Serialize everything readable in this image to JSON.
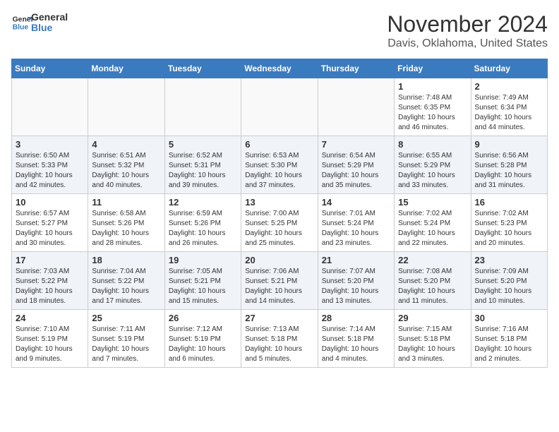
{
  "logo": {
    "line1": "General",
    "line2": "Blue"
  },
  "title": "November 2024",
  "location": "Davis, Oklahoma, United States",
  "weekdays": [
    "Sunday",
    "Monday",
    "Tuesday",
    "Wednesday",
    "Thursday",
    "Friday",
    "Saturday"
  ],
  "weeks": [
    [
      {
        "day": "",
        "info": ""
      },
      {
        "day": "",
        "info": ""
      },
      {
        "day": "",
        "info": ""
      },
      {
        "day": "",
        "info": ""
      },
      {
        "day": "",
        "info": ""
      },
      {
        "day": "1",
        "info": "Sunrise: 7:48 AM\nSunset: 6:35 PM\nDaylight: 10 hours and 46 minutes."
      },
      {
        "day": "2",
        "info": "Sunrise: 7:49 AM\nSunset: 6:34 PM\nDaylight: 10 hours and 44 minutes."
      }
    ],
    [
      {
        "day": "3",
        "info": "Sunrise: 6:50 AM\nSunset: 5:33 PM\nDaylight: 10 hours and 42 minutes."
      },
      {
        "day": "4",
        "info": "Sunrise: 6:51 AM\nSunset: 5:32 PM\nDaylight: 10 hours and 40 minutes."
      },
      {
        "day": "5",
        "info": "Sunrise: 6:52 AM\nSunset: 5:31 PM\nDaylight: 10 hours and 39 minutes."
      },
      {
        "day": "6",
        "info": "Sunrise: 6:53 AM\nSunset: 5:30 PM\nDaylight: 10 hours and 37 minutes."
      },
      {
        "day": "7",
        "info": "Sunrise: 6:54 AM\nSunset: 5:29 PM\nDaylight: 10 hours and 35 minutes."
      },
      {
        "day": "8",
        "info": "Sunrise: 6:55 AM\nSunset: 5:29 PM\nDaylight: 10 hours and 33 minutes."
      },
      {
        "day": "9",
        "info": "Sunrise: 6:56 AM\nSunset: 5:28 PM\nDaylight: 10 hours and 31 minutes."
      }
    ],
    [
      {
        "day": "10",
        "info": "Sunrise: 6:57 AM\nSunset: 5:27 PM\nDaylight: 10 hours and 30 minutes."
      },
      {
        "day": "11",
        "info": "Sunrise: 6:58 AM\nSunset: 5:26 PM\nDaylight: 10 hours and 28 minutes."
      },
      {
        "day": "12",
        "info": "Sunrise: 6:59 AM\nSunset: 5:26 PM\nDaylight: 10 hours and 26 minutes."
      },
      {
        "day": "13",
        "info": "Sunrise: 7:00 AM\nSunset: 5:25 PM\nDaylight: 10 hours and 25 minutes."
      },
      {
        "day": "14",
        "info": "Sunrise: 7:01 AM\nSunset: 5:24 PM\nDaylight: 10 hours and 23 minutes."
      },
      {
        "day": "15",
        "info": "Sunrise: 7:02 AM\nSunset: 5:24 PM\nDaylight: 10 hours and 22 minutes."
      },
      {
        "day": "16",
        "info": "Sunrise: 7:02 AM\nSunset: 5:23 PM\nDaylight: 10 hours and 20 minutes."
      }
    ],
    [
      {
        "day": "17",
        "info": "Sunrise: 7:03 AM\nSunset: 5:22 PM\nDaylight: 10 hours and 18 minutes."
      },
      {
        "day": "18",
        "info": "Sunrise: 7:04 AM\nSunset: 5:22 PM\nDaylight: 10 hours and 17 minutes."
      },
      {
        "day": "19",
        "info": "Sunrise: 7:05 AM\nSunset: 5:21 PM\nDaylight: 10 hours and 15 minutes."
      },
      {
        "day": "20",
        "info": "Sunrise: 7:06 AM\nSunset: 5:21 PM\nDaylight: 10 hours and 14 minutes."
      },
      {
        "day": "21",
        "info": "Sunrise: 7:07 AM\nSunset: 5:20 PM\nDaylight: 10 hours and 13 minutes."
      },
      {
        "day": "22",
        "info": "Sunrise: 7:08 AM\nSunset: 5:20 PM\nDaylight: 10 hours and 11 minutes."
      },
      {
        "day": "23",
        "info": "Sunrise: 7:09 AM\nSunset: 5:20 PM\nDaylight: 10 hours and 10 minutes."
      }
    ],
    [
      {
        "day": "24",
        "info": "Sunrise: 7:10 AM\nSunset: 5:19 PM\nDaylight: 10 hours and 9 minutes."
      },
      {
        "day": "25",
        "info": "Sunrise: 7:11 AM\nSunset: 5:19 PM\nDaylight: 10 hours and 7 minutes."
      },
      {
        "day": "26",
        "info": "Sunrise: 7:12 AM\nSunset: 5:19 PM\nDaylight: 10 hours and 6 minutes."
      },
      {
        "day": "27",
        "info": "Sunrise: 7:13 AM\nSunset: 5:18 PM\nDaylight: 10 hours and 5 minutes."
      },
      {
        "day": "28",
        "info": "Sunrise: 7:14 AM\nSunset: 5:18 PM\nDaylight: 10 hours and 4 minutes."
      },
      {
        "day": "29",
        "info": "Sunrise: 7:15 AM\nSunset: 5:18 PM\nDaylight: 10 hours and 3 minutes."
      },
      {
        "day": "30",
        "info": "Sunrise: 7:16 AM\nSunset: 5:18 PM\nDaylight: 10 hours and 2 minutes."
      }
    ]
  ]
}
